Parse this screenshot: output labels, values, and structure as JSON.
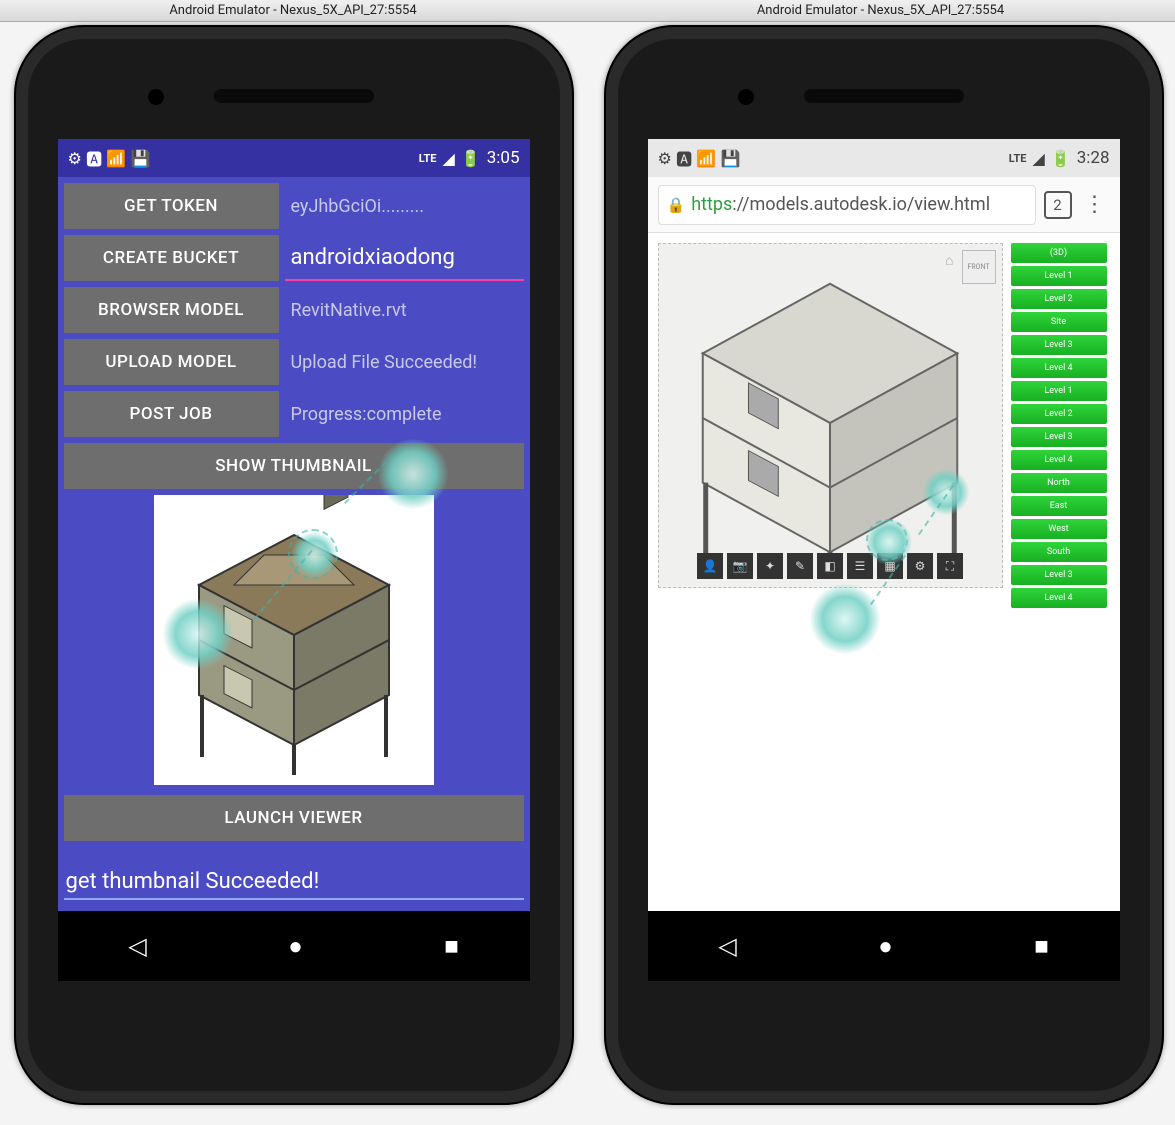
{
  "window": {
    "title_left": "Android Emulator - Nexus_5X_API_27:5554",
    "title_right": "Android Emulator - Nexus_5X_API_27:5554"
  },
  "left_screen": {
    "status": {
      "lte": "LTE",
      "time": "3:05"
    },
    "rows": {
      "get_token": {
        "btn": "GET TOKEN",
        "val": "eyJhbGciOi........."
      },
      "create_bucket": {
        "btn": "CREATE BUCKET",
        "val": "androidxiaodong"
      },
      "browser_model": {
        "btn": "BROWSER MODEL",
        "val": "RevitNative.rvt"
      },
      "upload_model": {
        "btn": "UPLOAD MODEL",
        "val": "Upload File Succeeded!"
      },
      "post_job": {
        "btn": "POST JOB",
        "val": "Progress:complete"
      }
    },
    "show_thumbnail_btn": "SHOW THUMBNAIL",
    "launch_viewer_btn": "LAUNCH VIEWER",
    "status_line": "get thumbnail Succeeded!"
  },
  "right_screen": {
    "status": {
      "lte": "LTE",
      "time": "3:28"
    },
    "url": {
      "scheme": "https",
      "rest": "://models.autodesk.io/view.html"
    },
    "tab_count": "2",
    "view_cube": "FRONT",
    "tree_items": [
      "(3D)",
      "Level 1",
      "Level 2",
      "Site",
      "Level 3",
      "Level 4",
      "Level 1",
      "Level 2",
      "Level 3",
      "Level 4",
      "North",
      "East",
      "West",
      "South",
      "Level 3",
      "Level 4"
    ],
    "toolbar_icons": [
      "person-icon",
      "camera-icon",
      "wand-icon",
      "pencil-icon",
      "cube-icon",
      "tree-icon",
      "grid-icon",
      "gear-icon",
      "expand-icon"
    ]
  },
  "nav": {
    "back": "◁",
    "home": "●",
    "recent": "■"
  }
}
